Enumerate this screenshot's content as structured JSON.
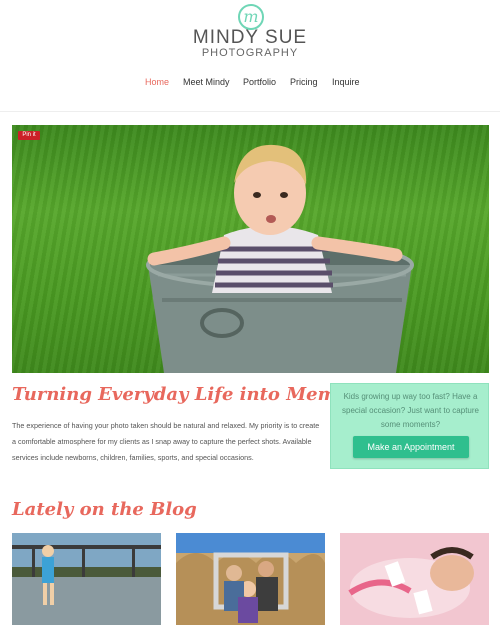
{
  "brand": {
    "mark": "m",
    "title": "MINDY SUE",
    "subtitle": "PHOTOGRAPHY",
    "accent_color": "#6fd6b6"
  },
  "nav": {
    "items": [
      {
        "label": "Home",
        "active": true
      },
      {
        "label": "Meet Mindy",
        "active": false
      },
      {
        "label": "Portfolio",
        "active": false
      },
      {
        "label": "Pricing",
        "active": false
      },
      {
        "label": "Inquire",
        "active": false
      }
    ],
    "active_color": "#e8685d"
  },
  "hero": {
    "pin_label": "Pin it",
    "image": "toddler-in-metal-tub-on-grass"
  },
  "intro": {
    "heading": "Turning Everyday Life into Memories",
    "body": "The experience of having your photo taken should be natural and relaxed. My priority is to create a comfortable atmosphere for my clients as I snap away to capture the perfect shots. Available services include newborns, children, families, sports, and special occasions."
  },
  "cta": {
    "text": "Kids growing up way too fast? Have a special occasion? Just want to capture some moments?",
    "button_label": "Make an Appointment",
    "box_color": "#a6eecd",
    "button_color": "#2fbf8e"
  },
  "blog": {
    "heading": "Lately on the Blog",
    "posts": [
      {
        "image": "child-walking-by-lake-and-dock"
      },
      {
        "image": "family-with-picture-frame-in-tall-grass"
      },
      {
        "image": "newborn-wrapped-in-pink"
      }
    ]
  }
}
